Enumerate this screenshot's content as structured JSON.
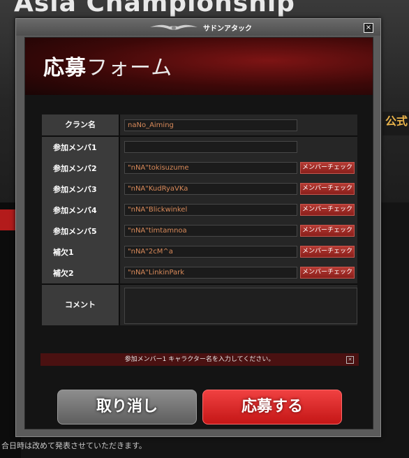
{
  "background": {
    "title": "Asia Championship",
    "right_badge": "公式",
    "bottom_text": "合日時は改めて発表させていただきます。"
  },
  "window": {
    "title": "サドンアタック",
    "close_symbol": "×"
  },
  "form": {
    "title_bold": "応募",
    "title_rest": "フォーム",
    "clan_label": "クラン名",
    "clan_value": "naNo_Aiming",
    "members": [
      {
        "label": "参加メンバ1",
        "value": "",
        "has_check": false
      },
      {
        "label": "参加メンバ2",
        "value": "\"nNA\"tokisuzume",
        "has_check": true
      },
      {
        "label": "参加メンバ3",
        "value": "\"nNA\"KudRyaVKa",
        "has_check": true
      },
      {
        "label": "参加メンバ4",
        "value": "\"nNA\"Blickwinkel",
        "has_check": true
      },
      {
        "label": "参加メンバ5",
        "value": "\"nNA\"timtamnoa",
        "has_check": true
      },
      {
        "label": "補欠1",
        "value": "\"nNA\"2cM^a",
        "has_check": true
      },
      {
        "label": "補欠2",
        "value": "\"nNA\"LinkinPark",
        "has_check": true
      }
    ],
    "check_button_label": "メンバーチェック",
    "comment_label": "コメント",
    "comment_value": ""
  },
  "notice": {
    "text": "参加メンバー1 キャラクター名を入力してください。"
  },
  "buttons": {
    "cancel": "取り消し",
    "apply": "応募する"
  }
}
